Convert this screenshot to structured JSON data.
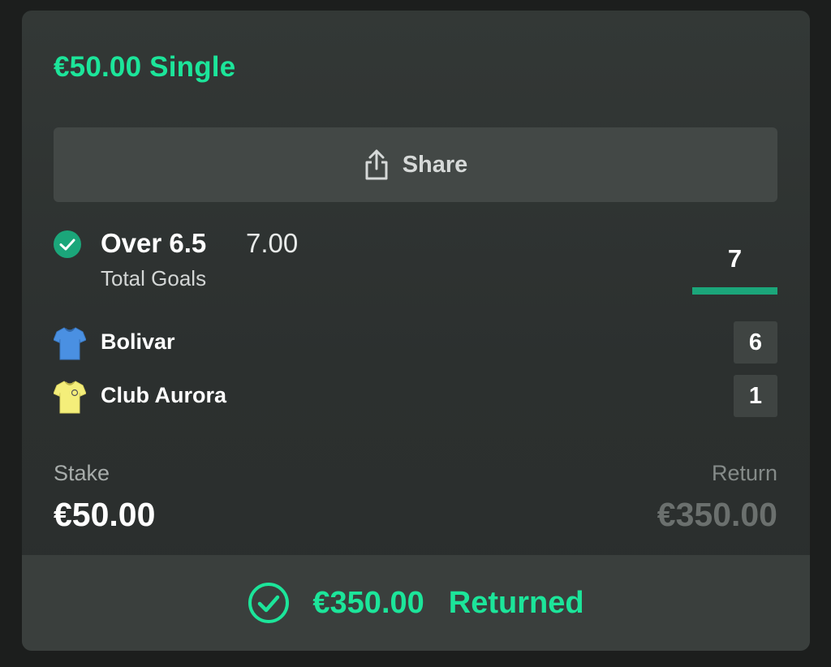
{
  "bet": {
    "title": "€50.00 Single",
    "share_label": "Share",
    "selection": {
      "name": "Over 6.5",
      "odds": "7.00",
      "market": "Total Goals",
      "status": "won"
    },
    "total_score": "7",
    "teams": [
      {
        "name": "Bolivar",
        "score": "6",
        "shirt_color": "#4a90e2"
      },
      {
        "name": "Club Aurora",
        "score": "1",
        "shirt_color": "#f4ee7a"
      }
    ],
    "stake_label": "Stake",
    "stake_value": "€50.00",
    "return_label": "Return",
    "return_value": "€350.00",
    "footer": {
      "amount": "€350.00",
      "status": "Returned"
    }
  },
  "colors": {
    "accent": "#1ce59a",
    "success_check": "#1ba67a",
    "card_bg": "#333836",
    "button_bg": "#434846"
  },
  "icons": {
    "share": "share-icon",
    "selection_check": "check-circle-icon",
    "footer_check": "check-circle-outline-icon",
    "shirt": "shirt-icon"
  }
}
